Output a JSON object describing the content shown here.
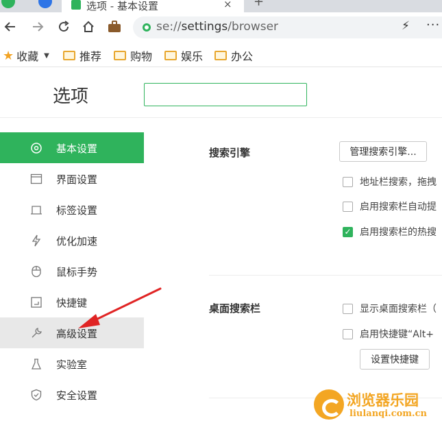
{
  "browser": {
    "tab_title": "选项 - 基本设置",
    "tab_close": "×",
    "new_tab": "+",
    "address_scheme": "se://",
    "address_host": "settings",
    "address_path": "/browser",
    "bolt": "⚡",
    "more": "···"
  },
  "bookmarks": [
    {
      "label": "收藏",
      "icon": "star-icon"
    },
    {
      "label": "推荐",
      "icon": "folder-icon"
    },
    {
      "label": "购物",
      "icon": "folder-icon"
    },
    {
      "label": "娱乐",
      "icon": "folder-icon"
    },
    {
      "label": "办公",
      "icon": "folder-icon"
    }
  ],
  "page": {
    "title": "选项",
    "search_value": ""
  },
  "sidebar": {
    "items": [
      {
        "label": "基本设置",
        "icon": "gear-icon",
        "state": "active"
      },
      {
        "label": "界面设置",
        "icon": "window-icon"
      },
      {
        "label": "标签设置",
        "icon": "tab-icon"
      },
      {
        "label": "优化加速",
        "icon": "lightning-icon"
      },
      {
        "label": "鼠标手势",
        "icon": "mouse-icon"
      },
      {
        "label": "快捷键",
        "icon": "keyboard-shortcut-icon"
      },
      {
        "label": "高级设置",
        "icon": "wrench-icon",
        "state": "hover"
      },
      {
        "label": "实验室",
        "icon": "flask-icon"
      },
      {
        "label": "安全设置",
        "icon": "shield-icon"
      }
    ]
  },
  "search_engine": {
    "title": "搜索引擎",
    "manage_button": "管理搜索引擎...",
    "options": [
      {
        "label": "地址栏搜索，拖拽",
        "checked": false
      },
      {
        "label": "启用搜索栏自动提",
        "checked": false
      },
      {
        "label": "启用搜索栏的热搜",
        "checked": true
      }
    ]
  },
  "desktop_search": {
    "title": "桌面搜索栏",
    "options": [
      {
        "label": "显示桌面搜索栏（",
        "checked": false
      },
      {
        "label": "启用快捷键“Alt+",
        "checked": false
      }
    ],
    "shortcut_button": "设置快捷键"
  },
  "watermark": {
    "title": "浏览器乐园",
    "url": "liulanqi.com.cn"
  },
  "colors": {
    "accent": "#2fb35c",
    "arrow": "#e02424",
    "watermark": "#f3a623"
  }
}
